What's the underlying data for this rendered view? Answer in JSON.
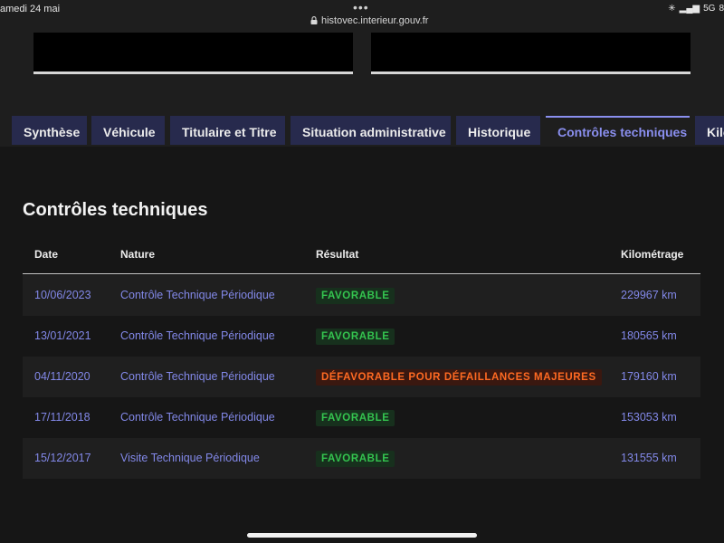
{
  "status_bar": {
    "date": "amedi 24 mai",
    "dots": "•••",
    "url": "histovec.interieur.gouv.fr",
    "network": "5G",
    "battery": "8"
  },
  "tabs": [
    {
      "label": "Synthèse",
      "active": false
    },
    {
      "label": "Véhicule",
      "active": false
    },
    {
      "label": "Titulaire et Titre",
      "active": false
    },
    {
      "label": "Situation administrative",
      "active": false
    },
    {
      "label": "Historique",
      "active": false
    },
    {
      "label": "Contrôles techniques",
      "active": true
    },
    {
      "label": "Kilo",
      "active": false
    }
  ],
  "section": {
    "title": "Contrôles techniques"
  },
  "table": {
    "headers": {
      "date": "Date",
      "nature": "Nature",
      "resultat": "Résultat",
      "kilometrage": "Kilométrage"
    },
    "rows": [
      {
        "date": "10/06/2023",
        "nature": "Contrôle Technique Périodique",
        "resultat": "FAVORABLE",
        "status": "ok",
        "km": "229967 km"
      },
      {
        "date": "13/01/2021",
        "nature": "Contrôle Technique Périodique",
        "resultat": "FAVORABLE",
        "status": "ok",
        "km": "180565 km"
      },
      {
        "date": "04/11/2020",
        "nature": "Contrôle Technique Périodique",
        "resultat": "DÉFAVORABLE POUR DÉFAILLANCES MAJEURES",
        "status": "ko",
        "km": "179160 km"
      },
      {
        "date": "17/11/2018",
        "nature": "Contrôle Technique Périodique",
        "resultat": "FAVORABLE",
        "status": "ok",
        "km": "153053 km"
      },
      {
        "date": "15/12/2017",
        "nature": "Visite Technique Périodique",
        "resultat": "FAVORABLE",
        "status": "ok",
        "km": "131555 km"
      }
    ]
  },
  "colors": {
    "accent": "#8a8fef",
    "link": "#8288e8",
    "favorable": "#34c44f",
    "defavorable": "#ff6a22",
    "tab_bg": "#272a4d"
  },
  "icons": {
    "lock": "lock-icon",
    "signal": "signal-icon",
    "spinner": "activity-icon"
  }
}
